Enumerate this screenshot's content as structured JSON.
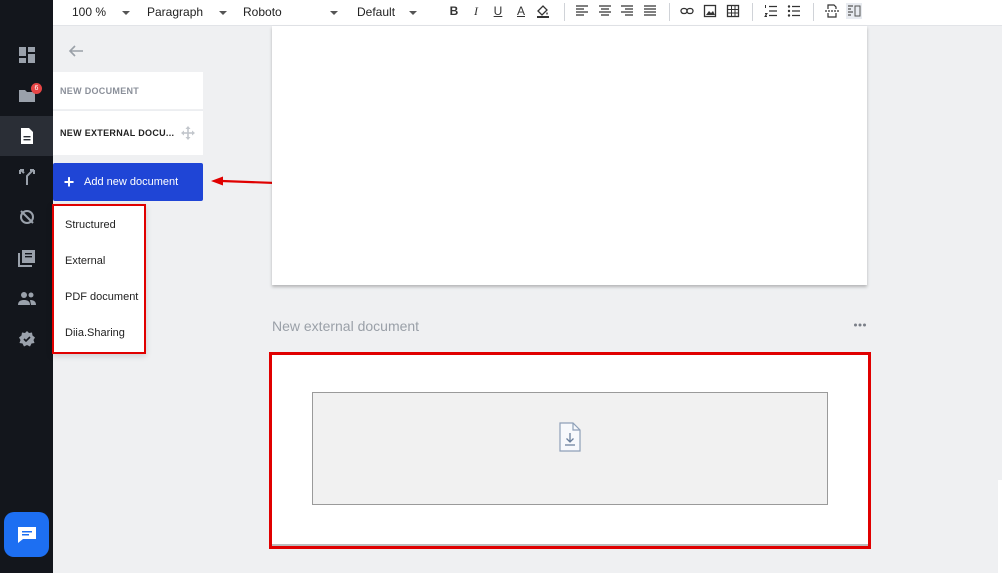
{
  "toolbar": {
    "zoom": "100 %",
    "block_style": "Paragraph",
    "font": "Roboto",
    "size": "Default",
    "bold_label": "B",
    "italic_label": "I",
    "underline_label": "U",
    "color_label": "A"
  },
  "rail": {
    "items": [
      {
        "icon": "dashboard-icon"
      },
      {
        "icon": "folder-icon",
        "badge": "6"
      },
      {
        "icon": "document-icon",
        "active": true
      },
      {
        "icon": "branch-icon"
      },
      {
        "icon": "sync-icon"
      },
      {
        "icon": "library-icon"
      },
      {
        "icon": "users-icon"
      },
      {
        "icon": "settings-badge-icon"
      }
    ]
  },
  "documents": {
    "items": [
      {
        "label": "NEW DOCUMENT"
      },
      {
        "label": "NEW EXTERNAL DOCU..."
      }
    ],
    "add_button": "Add new document"
  },
  "add_menu": {
    "options": [
      "Structured",
      "External",
      "PDF document",
      "Diia.Sharing"
    ]
  },
  "editor": {
    "section_title": "New external document"
  },
  "colors": {
    "accent": "#1f45d6",
    "annotation": "#e00000",
    "rail": "#13161c",
    "chat": "#1d6ff2"
  }
}
